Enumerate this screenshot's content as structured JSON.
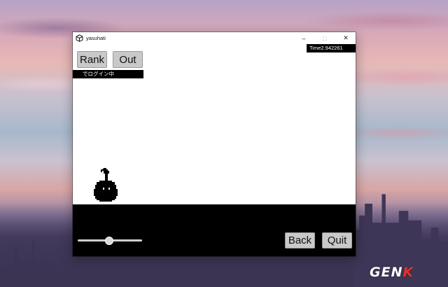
{
  "window": {
    "title": "yasuhati",
    "controls": {
      "minimize": "–",
      "maximize": "□",
      "close": "✕"
    }
  },
  "hud": {
    "time_text": "Time2.942261",
    "login_status": "でログイン中"
  },
  "buttons": {
    "rank": "Rank",
    "out": "Out",
    "back": "Back",
    "quit": "Quit"
  },
  "slider": {
    "value": 0.48
  },
  "watermark": {
    "text_main": "GEN",
    "text_accent": "K"
  },
  "colors": {
    "button_bg": "#c9c9c9",
    "ground": "#000000",
    "game_bg": "#ffffff",
    "watermark_accent": "#e8302c"
  },
  "icons": {
    "app": "unity-icon",
    "character": "black-blob-sprout-character"
  }
}
